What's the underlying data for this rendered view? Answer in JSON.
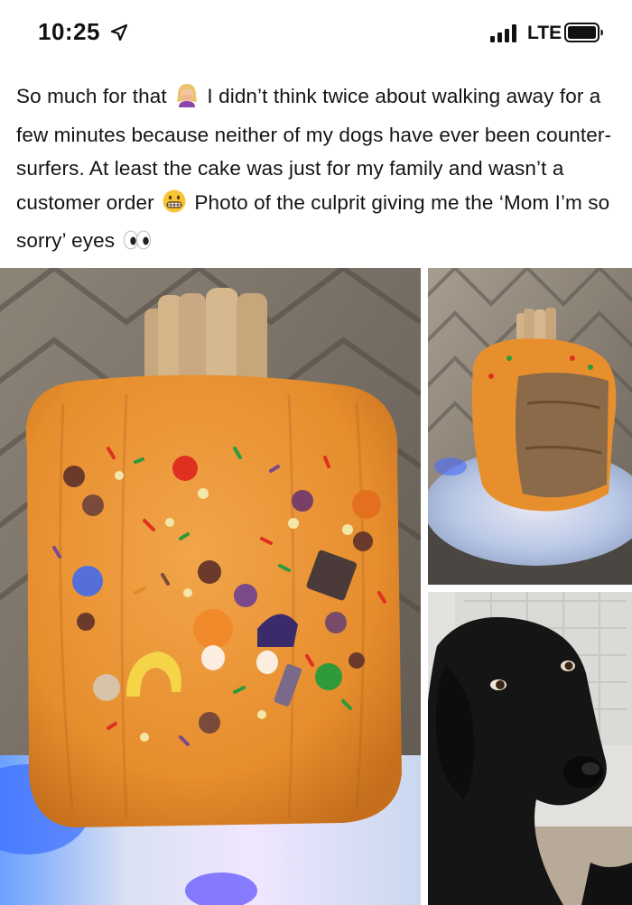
{
  "status_bar": {
    "time": "10:25",
    "network": "LTE",
    "icons": [
      "location-arrow-icon",
      "signal-bars-icon",
      "battery-icon"
    ]
  },
  "post": {
    "text_1": "So much for that ",
    "emoji_1": "woman-facepalming-emoji",
    "text_2": " I didn’t think twice about walking away for a few minutes because neither of my dogs have ever been counter-surfers. At least the cake was just for my family and wasn’t a customer order ",
    "emoji_2": "grimacing-face-emoji",
    "text_3": " Photo of the culprit giving me the ‘Mom I’m so sorry’ eyes ",
    "emoji_3": "eyes-emoji"
  },
  "photos": [
    {
      "name": "photo-pumpkin-cake-whole",
      "subject": "orange pumpkin-shaped cake with sprinkles and candy decorations"
    },
    {
      "name": "photo-pumpkin-cake-eaten",
      "subject": "pumpkin cake with one side eaten away on holographic board"
    },
    {
      "name": "photo-black-dog",
      "subject": "black dog looking up guiltily"
    }
  ]
}
